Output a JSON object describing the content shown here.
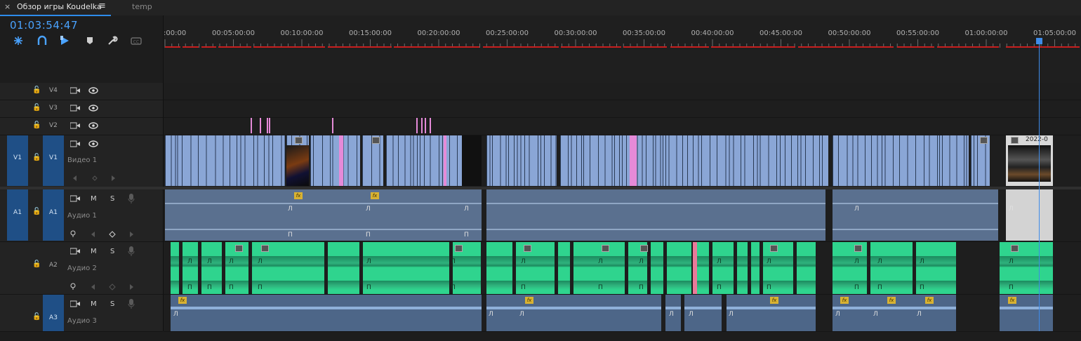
{
  "tabs": {
    "active": {
      "close": "×",
      "title": "Обзор игры Koudelka",
      "menu": "≡"
    },
    "inactive": {
      "title": "temp"
    }
  },
  "timecode": "01:03:54:47",
  "toolbar": [
    "snap-icon",
    "linked-selection-icon",
    "add-marker-icon",
    "marker-icon",
    "wrench-icon",
    "captions-icon"
  ],
  "ruler": {
    "labels": [
      ":00:00",
      "00:05:00:00",
      "00:10:00:00",
      "00:15:00:00",
      "00:20:00:00",
      "00:25:00:00",
      "00:30:00:00",
      "00:35:00:00",
      "00:40:00:00",
      "00:45:00:00",
      "00:50:00:00",
      "00:55:00:00",
      "01:00:00:00",
      "01:05:00:00"
    ]
  },
  "tracks": {
    "v4": {
      "label": "V4"
    },
    "v3": {
      "label": "V3"
    },
    "v2": {
      "label": "V2"
    },
    "v1": {
      "source": "V1",
      "label": "V1",
      "name": "Видео 1"
    },
    "a1": {
      "source": "A1",
      "label": "A1",
      "name": "Аудио 1",
      "m": "M",
      "s": "S"
    },
    "a2": {
      "label": "A2",
      "name": "Аудио 2",
      "m": "M",
      "s": "S"
    },
    "a3": {
      "label": "A3",
      "name": "Аудио 3",
      "m": "M",
      "s": "S"
    }
  },
  "clips": {
    "v1_last_clip_label": "2022-0",
    "fx_badge": "fx",
    "audio_mark": "Л",
    "audio_mark_bottom": "П"
  },
  "colors": {
    "accent": "#2d8ceb",
    "video_clip": "#8aa6d6",
    "audio1_clip": "#5a708f",
    "audio2_clip": "#2fd48e",
    "audio3_clip": "#4d6688",
    "marker_pink": "#e58ad8",
    "render_bar_red": "#c81e1e",
    "fx_yellow": "#d8b232"
  }
}
